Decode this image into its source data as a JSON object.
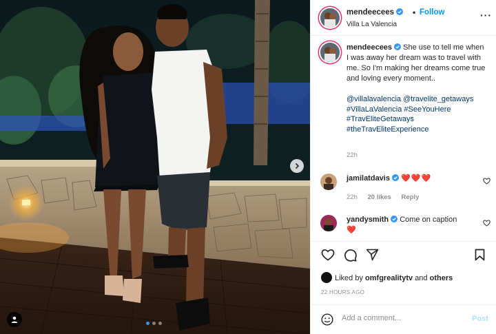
{
  "post": {
    "author": "mendeecees",
    "location": "Villa La Valencia",
    "follow_label": "Follow",
    "more_icon": "more-options-icon",
    "caption_text": "She use to tell me when I was away her dream was to travel with me. So I'm making her dreams come true and loving every moment..",
    "caption_tags": [
      "@villalavalencia @travelite_getaways",
      "#VillaLaValencia #SeeYouHere",
      "#TravEliteGetaways",
      "#theTravEliteExperience"
    ],
    "caption_time": "22h",
    "carousel_dots": 3,
    "carousel_active": 0
  },
  "comments": [
    {
      "user": "jamilatdavis",
      "text": "❤️❤️❤️",
      "time": "22h",
      "likes": "20 likes",
      "reply": "Reply"
    },
    {
      "user": "yandysmith",
      "text": "Come on caption",
      "text2": "❤️"
    }
  ],
  "likes": {
    "prefix": "Liked by",
    "user": "omfgrealitytv",
    "conj": "and",
    "others": "others"
  },
  "timestamp": "22 HOURS AGO",
  "add_comment": {
    "placeholder": "Add a comment...",
    "post_label": "Post"
  },
  "colors": {
    "accent": "#0095f6",
    "link": "#00376b",
    "heart": "#ed4956"
  }
}
